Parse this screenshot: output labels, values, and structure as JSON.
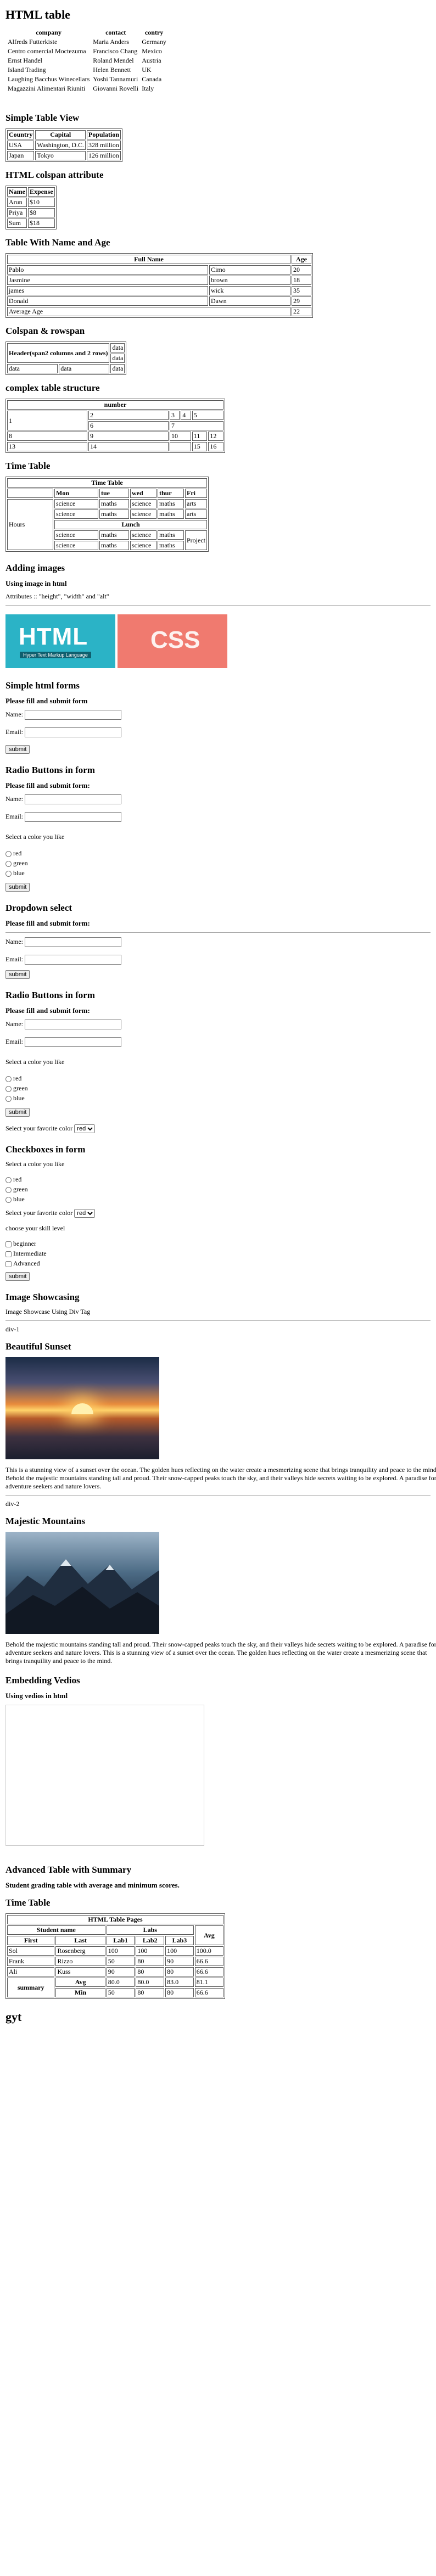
{
  "html_table": {
    "title": "HTML table",
    "headers": [
      "company",
      "contact",
      "contry"
    ],
    "rows": [
      [
        "Alfreds Futterkiste",
        "Maria Anders",
        "Germany"
      ],
      [
        "Centro comercial Moctezuma",
        "Francisco Chang",
        "Mexico"
      ],
      [
        "Ernst Handel",
        "Roland Mendel",
        "Austria"
      ],
      [
        "Island Trading",
        "Helen Bennett",
        "UK"
      ],
      [
        "Laughing Bacchus Winecellars",
        "Yoshi Tannamuri",
        "Canada"
      ],
      [
        "Magazzini Alimentari Riuniti",
        "Giovanni Rovelli",
        "Italy"
      ]
    ]
  },
  "simple_table": {
    "title": "Simple Table View",
    "headers": [
      "Country",
      "Capital",
      "Population"
    ],
    "rows": [
      [
        "USA",
        "Washington, D.C.",
        "328 million"
      ],
      [
        "Japan",
        "Tokyo",
        "126 million"
      ]
    ]
  },
  "colspan_table": {
    "title": "HTML colspan attribute",
    "headers": [
      "Name",
      "Expense"
    ],
    "rows": [
      [
        "Arun",
        "$10"
      ],
      [
        "Priya",
        "$8"
      ],
      [
        "Sum",
        "$18"
      ]
    ]
  },
  "name_age_table": {
    "title": "Table With Name and Age",
    "headers": [
      "Full Name",
      "Age"
    ],
    "rows": [
      [
        "Pablo",
        "Cimo",
        "20"
      ],
      [
        "Jasmine",
        "brown",
        "18"
      ],
      [
        "james",
        "wick",
        "35"
      ],
      [
        "Donald",
        "Dawn",
        "29"
      ]
    ],
    "footer": [
      "Average Age",
      "22"
    ]
  },
  "rowspan_table": {
    "title": "Colspan & rowspan",
    "header": "Header(span2 columns and 2 rows)",
    "data": "data"
  },
  "complex_table": {
    "title": "complex table structure",
    "header": "number",
    "cells": [
      "1",
      "2",
      "3",
      "4",
      "5",
      "6",
      "7",
      "8",
      "9",
      "10",
      "11",
      "12",
      "13",
      "14",
      "15",
      "16"
    ]
  },
  "time_table": {
    "title": "Time Table",
    "caption": "Time Table",
    "days": [
      "Mon",
      "tue",
      "wed",
      "thur",
      "Fri"
    ],
    "hours": "Hours",
    "row1": [
      "science",
      "maths",
      "science",
      "maths",
      "arts"
    ],
    "row2": [
      "science",
      "maths",
      "science",
      "maths",
      "arts"
    ],
    "lunch": "Lunch",
    "row3": [
      "science",
      "maths",
      "science",
      "maths"
    ],
    "row4": [
      "science",
      "maths",
      "science",
      "maths"
    ],
    "project": "Project"
  },
  "images": {
    "title": "Adding images",
    "subtitle": "Using image in html",
    "attributes": "Attributes :: \"height\", \"width\" and \"alt\"",
    "html_logo_text": "HTML",
    "html_logo_tag": "Hyper Text Markup Language",
    "css_logo_text": "CSS"
  },
  "simple_forms": {
    "title": "Simple html forms",
    "subtitle": "Please fill and submit form",
    "name_label": "Name:",
    "email_label": "Email:",
    "submit": "submit"
  },
  "radio_form": {
    "title": "Radio Buttons in form",
    "subtitle": "Please fill and submit form:",
    "name_label": "Name:",
    "email_label": "Email:",
    "color_prompt": "Select a color you like",
    "colors": [
      "red",
      "green",
      "blue"
    ],
    "submit": "submit"
  },
  "dropdown_form": {
    "title": "Dropdown select",
    "subtitle": "Please fill and submit form:",
    "name_label": "Name:",
    "email_label": "Email:",
    "submit": "submit"
  },
  "radio_form2": {
    "title": "Radio Buttons in form",
    "subtitle": "Please fill and submit form:",
    "name_label": "Name:",
    "email_label": "Email:",
    "color_prompt": "Select a color you like",
    "colors": [
      "red",
      "green",
      "blue"
    ],
    "submit": "submit",
    "fav_label": "Select your favorite color",
    "fav_value": "red"
  },
  "checkbox_form": {
    "title": "Checkboxes in form",
    "color_prompt": "Select a color you like",
    "colors": [
      "red",
      "green",
      "blue"
    ],
    "fav_label": "Select your favorite color",
    "fav_value": "red",
    "skill_prompt": "choose your skill level",
    "skills": [
      "beginner",
      "Intermediate",
      "Advanced"
    ],
    "submit": "submit"
  },
  "showcase": {
    "title": "Image Showcasing",
    "subtitle": "Image Showcase Using Div Tag",
    "div1": "div-1",
    "sunset_title": "Beautiful Sunset",
    "sunset_text": "This is a stunning view of a sunset over the ocean. The golden hues reflecting on the water create a mesmerizing scene that brings tranquility and peace to the mind. Behold the majestic mountains standing tall and proud. Their snow-capped peaks touch the sky, and their valleys hide secrets waiting to be explored. A paradise for adventure seekers and nature lovers.",
    "div2": "div-2",
    "mountain_title": "Majestic Mountains",
    "mountain_text": "Behold the majestic mountains standing tall and proud. Their snow-capped peaks touch the sky, and their valleys hide secrets waiting to be explored. A paradise for adventure seekers and nature lovers. This is a stunning view of a sunset over the ocean. The golden hues reflecting on the water create a mesmerizing scene that brings tranquility and peace to the mind."
  },
  "video": {
    "title": "Embedding Vedios",
    "subtitle": "Using vedios in html"
  },
  "summary": {
    "title": "Advanced Table with Summary",
    "subtitle": "Student grading table with average and minimum scores.",
    "time_title": "Time Table",
    "caption": "HTML Table Pages",
    "student_name": "Student name",
    "labs": "Labs",
    "avg": "Avg",
    "first": "First",
    "last": "Last",
    "lab_headers": [
      "Lab1",
      "Lab2",
      "Lab3"
    ],
    "rows": [
      [
        "Sol",
        "Rosenberg",
        "100",
        "100",
        "100",
        "100.0"
      ],
      [
        "Frank",
        "Rizzo",
        "50",
        "80",
        "90",
        "66.6"
      ],
      [
        "Ali",
        "Kuss",
        "90",
        "80",
        "80",
        "66.6"
      ]
    ],
    "summary_label": "summary",
    "avg_label": "Avg",
    "avg_values": [
      "80.0",
      "80.0",
      "83.0",
      "81.1"
    ],
    "min_label": "Min",
    "min_values": [
      "50",
      "80",
      "80",
      "66.6"
    ]
  },
  "footer": {
    "title": "gyt"
  }
}
